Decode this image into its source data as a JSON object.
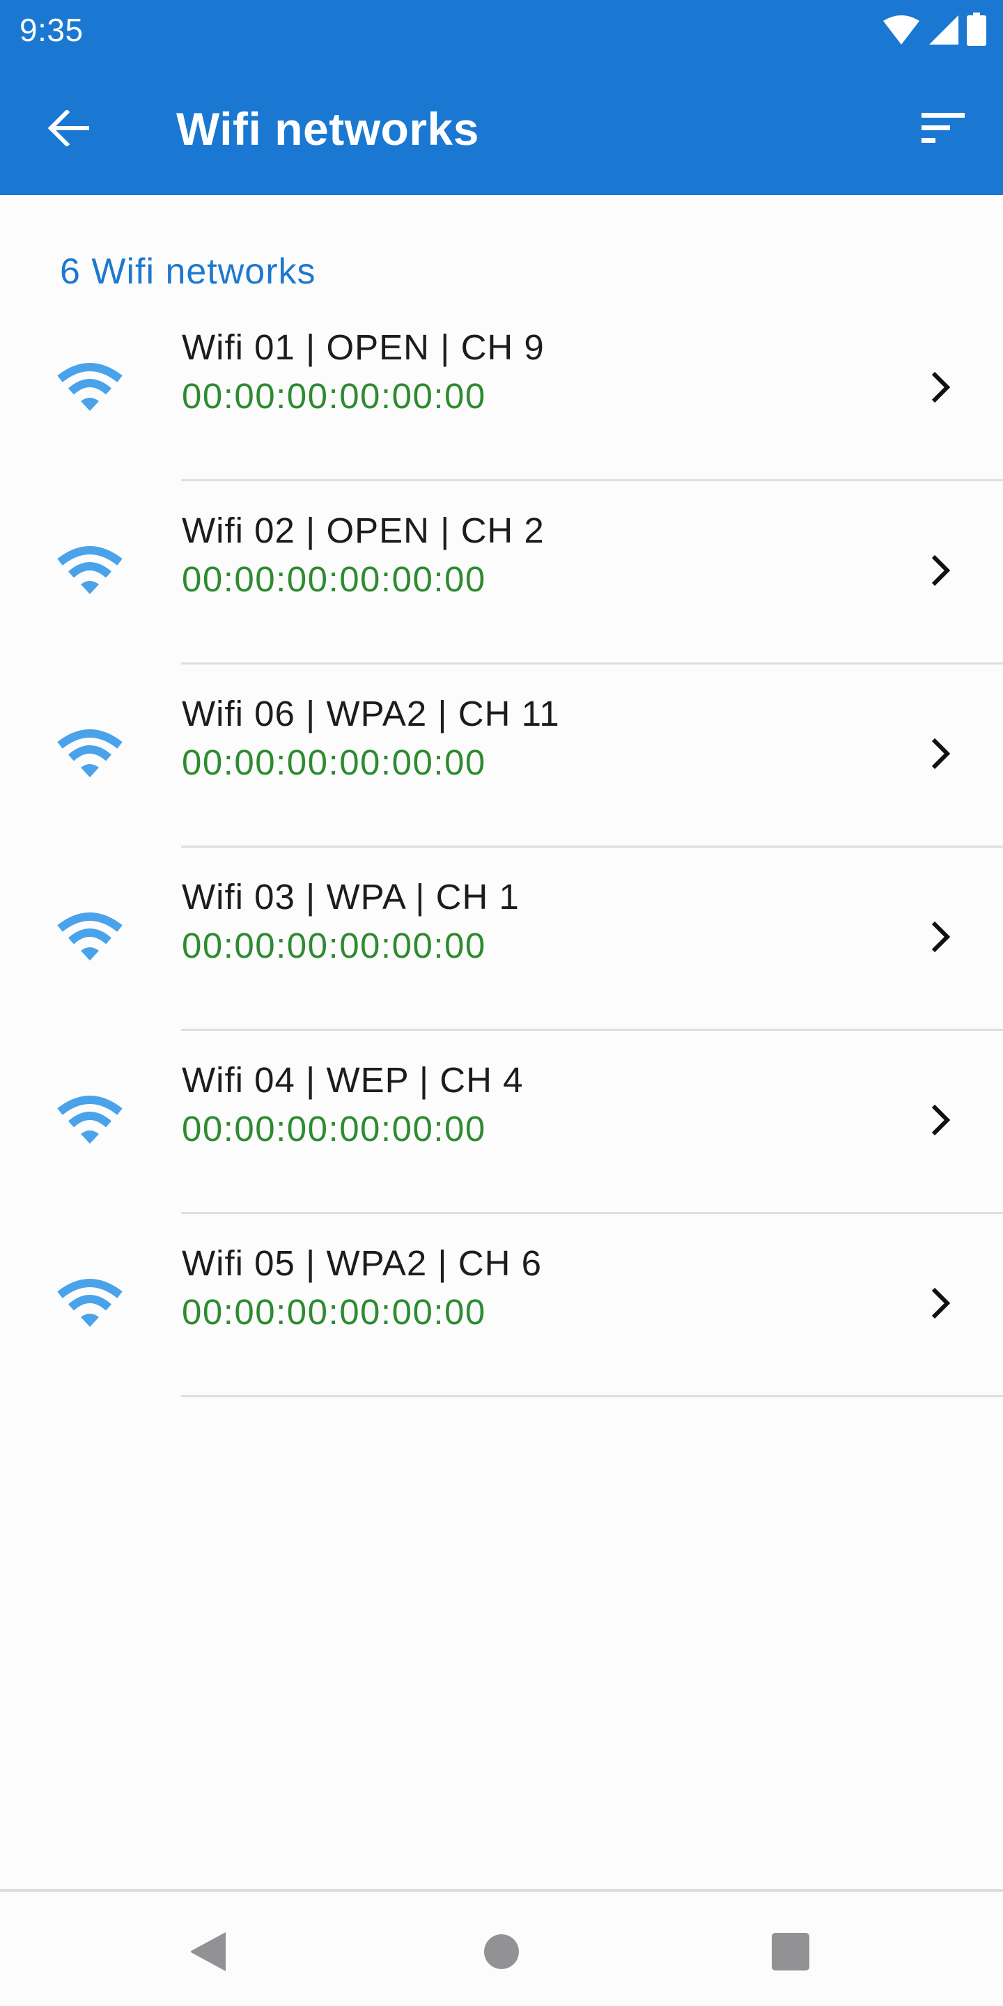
{
  "status_bar": {
    "time": "9:35",
    "icons": [
      "wifi-signal-icon",
      "cellular-signal-icon",
      "battery-icon"
    ]
  },
  "app_bar": {
    "back_icon": "arrow-left-icon",
    "title": "Wifi networks",
    "sort_icon": "sort-icon",
    "background_color": "#1a78d2"
  },
  "list": {
    "header": "6 Wifi networks",
    "items": [
      {
        "title": "Wifi 01 | OPEN | CH 9",
        "mac": "00:00:00:00:00:00"
      },
      {
        "title": "Wifi 02 | OPEN | CH 2",
        "mac": "00:00:00:00:00:00"
      },
      {
        "title": "Wifi 06 | WPA2 | CH 11",
        "mac": "00:00:00:00:00:00"
      },
      {
        "title": "Wifi 03 | WPA | CH 1",
        "mac": "00:00:00:00:00:00"
      },
      {
        "title": "Wifi 04 | WEP | CH 4",
        "mac": "00:00:00:00:00:00"
      },
      {
        "title": "Wifi 05 | WPA2 | CH 6",
        "mac": "00:00:00:00:00:00"
      }
    ],
    "item_icon": "wifi-icon",
    "trailing_icon": "chevron-right-icon",
    "header_color": "#1e78cf",
    "mac_color": "#2e8b30",
    "icon_color": "#4aa3ea"
  },
  "nav_bar": {
    "buttons": [
      "back",
      "home",
      "recents"
    ]
  }
}
